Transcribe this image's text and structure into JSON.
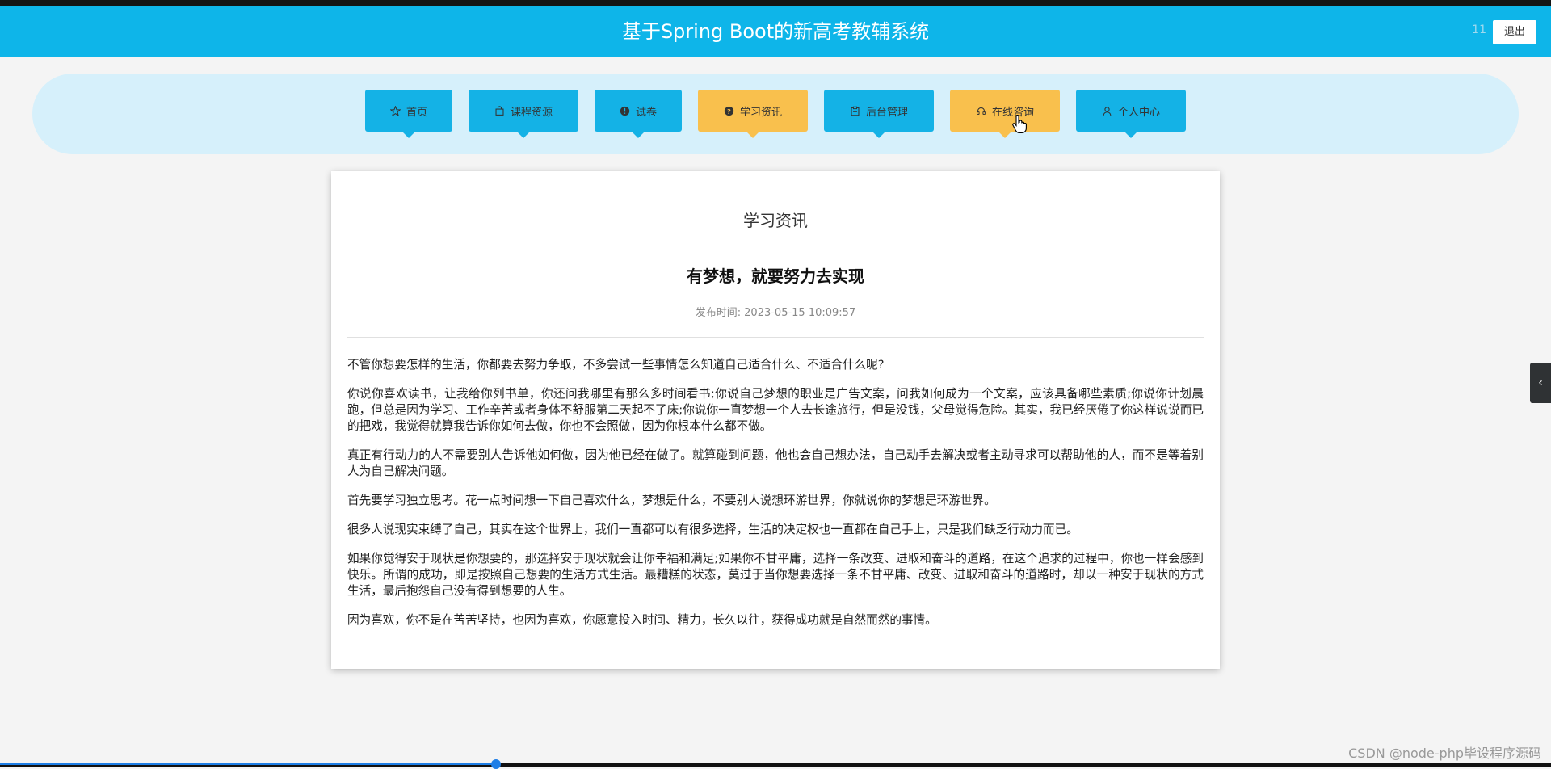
{
  "header": {
    "title": "基于Spring Boot的新高考教辅系统",
    "user": "11",
    "logout_label": "退出",
    "color": "#0eb5e9"
  },
  "nav": {
    "items": [
      {
        "label": "首页",
        "icon": "star-icon",
        "color": "blue"
      },
      {
        "label": "课程资源",
        "icon": "bag-icon",
        "color": "blue"
      },
      {
        "label": "试卷",
        "icon": "info-icon",
        "color": "blue"
      },
      {
        "label": "学习资讯",
        "icon": "question-icon",
        "color": "orange",
        "active": true
      },
      {
        "label": "后台管理",
        "icon": "clipboard-icon",
        "color": "blue"
      },
      {
        "label": "在线咨询",
        "icon": "headset-icon",
        "color": "orange",
        "hovered": true
      },
      {
        "label": "个人中心",
        "icon": "user-icon",
        "color": "blue"
      }
    ],
    "blue": "#14b2e6",
    "orange": "#f9c04d"
  },
  "article": {
    "section_title": "学习资讯",
    "title": "有梦想，就要努力去实现",
    "publish_label": "发布时间:",
    "publish_time": "2023-05-15 10:09:57",
    "paragraphs": [
      "不管你想要怎样的生活，你都要去努力争取，不多尝试一些事情怎么知道自己适合什么、不适合什么呢?",
      "你说你喜欢读书，让我给你列书单，你还问我哪里有那么多时间看书;你说自己梦想的职业是广告文案，问我如何成为一个文案，应该具备哪些素质;你说你计划晨跑，但总是因为学习、工作辛苦或者身体不舒服第二天起不了床;你说你一直梦想一个人去长途旅行，但是没钱，父母觉得危险。其实，我已经厌倦了你这样说说而已的把戏，我觉得就算我告诉你如何去做，你也不会照做，因为你根本什么都不做。",
      "真正有行动力的人不需要别人告诉他如何做，因为他已经在做了。就算碰到问题，他也会自己想办法，自己动手去解决或者主动寻求可以帮助他的人，而不是等着别人为自己解决问题。",
      "首先要学习独立思考。花一点时间想一下自己喜欢什么，梦想是什么，不要别人说想环游世界，你就说你的梦想是环游世界。",
      "很多人说现实束缚了自己，其实在这个世界上，我们一直都可以有很多选择，生活的决定权也一直都在自己手上，只是我们缺乏行动力而已。",
      "如果你觉得安于现状是你想要的，那选择安于现状就会让你幸福和满足;如果你不甘平庸，选择一条改变、进取和奋斗的道路，在这个追求的过程中，你也一样会感到快乐。所谓的成功，即是按照自己想要的生活方式生活。最糟糕的状态，莫过于当你想要选择一条不甘平庸、改变、进取和奋斗的道路时，却以一种安于现状的方式生活，最后抱怨自己没有得到想要的人生。",
      "因为喜欢，你不是在苦苦坚持，也因为喜欢，你愿意投入时间、精力，长久以往，获得成功就是自然而然的事情。"
    ]
  },
  "video_progress": 0.32,
  "watermark": "CSDN @node-php毕设程序源码"
}
